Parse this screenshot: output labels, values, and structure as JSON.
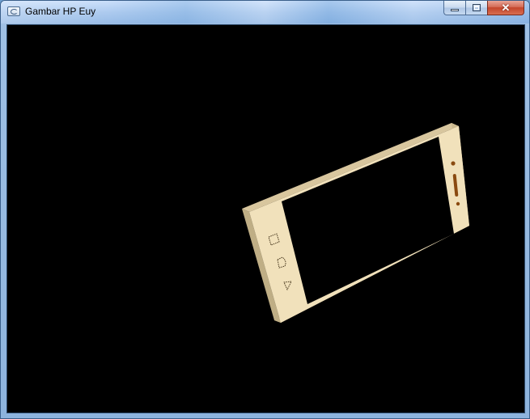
{
  "window": {
    "title": "Gambar HP Euy",
    "app_icon": "opengl-window-icon",
    "controls": {
      "minimize_icon": "minimize-icon",
      "maximize_icon": "maximize-icon",
      "close_icon": "close-icon",
      "close_glyph": "✕"
    }
  },
  "scene": {
    "background_color": "#000000",
    "phone_body_color": "#f1e1bb",
    "phone_side_color": "#d6c49b",
    "screen_color": "#000000",
    "nav_buttons": [
      "recent-apps-square-icon",
      "home-circle-icon",
      "back-triangle-icon"
    ],
    "accent_color": "#8a4a10"
  }
}
